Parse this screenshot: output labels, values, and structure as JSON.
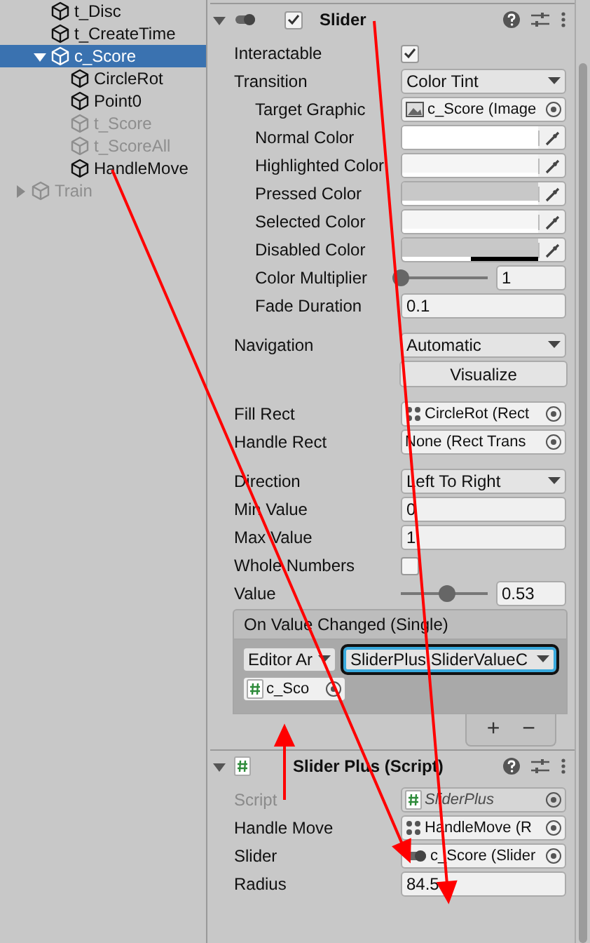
{
  "hierarchy": {
    "items": [
      {
        "label": "t_Disc",
        "selected": false,
        "disabled": false
      },
      {
        "label": "t_CreateTime",
        "selected": false,
        "disabled": false
      },
      {
        "label": "c_Score",
        "selected": true,
        "disabled": false,
        "expanded": true,
        "children": [
          {
            "label": "CircleRot",
            "selected": false,
            "disabled": false
          },
          {
            "label": "Point0",
            "selected": false,
            "disabled": false
          },
          {
            "label": "t_Score",
            "selected": false,
            "disabled": true
          },
          {
            "label": "t_ScoreAll",
            "selected": false,
            "disabled": true
          },
          {
            "label": "HandleMove",
            "selected": false,
            "disabled": false
          }
        ]
      }
    ],
    "root_items": [
      {
        "label": "Train",
        "selected": false,
        "disabled": true,
        "expanded": false
      }
    ]
  },
  "inspector": {
    "components": [
      {
        "title": "Slider",
        "kind": "slider",
        "expanded": true,
        "enabled": true,
        "groups": [
          [
            {
              "kind": "checkbox",
              "label": "Interactable",
              "checked": true
            },
            {
              "kind": "dropdown",
              "label": "Transition",
              "value": "Color Tint",
              "children": [
                {
                  "kind": "object",
                  "label": "Target Graphic",
                  "ref": {
                    "kind": "image",
                    "value": "c_Score (Image"
                  },
                  "disabled": false
                },
                {
                  "kind": "color",
                  "label": "Normal Color",
                  "color": "#ffffff",
                  "level": 1
                },
                {
                  "kind": "color",
                  "label": "Highlighted Color",
                  "color": "#f5f5f5",
                  "level": 1
                },
                {
                  "kind": "color",
                  "label": "Pressed Color",
                  "color": "#c8c8c8",
                  "level": 1
                },
                {
                  "kind": "color",
                  "label": "Selected Color",
                  "color": "#f5f5f5",
                  "level": 1
                },
                {
                  "kind": "color",
                  "label": "Disabled Color",
                  "color": "#c8c8c8",
                  "level": 0.5
                },
                {
                  "kind": "slider",
                  "label": "Color Multiplier",
                  "level": 0,
                  "value": "1"
                },
                {
                  "kind": "number",
                  "label": "Fade Duration",
                  "value": "0.1"
                }
              ]
            }
          ],
          [
            {
              "kind": "dropdown",
              "label": "Navigation",
              "value": "Automatic"
            },
            {
              "kind": "button",
              "value": "Visualize"
            }
          ],
          [
            {
              "kind": "object",
              "label": "Fill Rect",
              "ref": {
                "kind": "rect",
                "value": "CircleRot (Rect"
              },
              "disabled": false
            },
            {
              "kind": "object",
              "label": "Handle Rect",
              "ref": {
                "kind": "none",
                "value": "None (Rect Trans"
              },
              "disabled": false
            }
          ],
          [
            {
              "kind": "dropdown",
              "label": "Direction",
              "value": "Left To Right"
            },
            {
              "kind": "number",
              "label": "Min Value",
              "value": "0"
            },
            {
              "kind": "number",
              "label": "Max Value",
              "value": "1"
            },
            {
              "kind": "checkbox",
              "label": "Whole Numbers",
              "checked": false
            },
            {
              "kind": "slider",
              "label": "Value",
              "level": 0.53,
              "value": "0.53"
            }
          ]
        ],
        "event": {
          "title": "On Value Changed (Single)",
          "entries": [
            {
              "runtime": "Editor Ar",
              "function": "SliderPlus.SliderValueC",
              "function_selected": true,
              "object": "c_Sco"
            }
          ],
          "add": "+",
          "remove": "−"
        }
      },
      {
        "title": "Slider Plus (Script)",
        "kind": "script",
        "expanded": true,
        "groups": [
          [
            {
              "kind": "object",
              "label": "Script",
              "ref": {
                "kind": "script",
                "value": "SliderPlus"
              },
              "disabled": true
            },
            {
              "kind": "object",
              "label": "Handle Move",
              "ref": {
                "kind": "rect",
                "value": "HandleMove (R"
              },
              "disabled": false
            },
            {
              "kind": "object",
              "label": "Slider",
              "ref": {
                "kind": "slider",
                "value": "c_Score (Slider"
              },
              "disabled": false
            },
            {
              "kind": "number",
              "label": "Radius",
              "value": "84.5"
            }
          ]
        ]
      }
    ]
  }
}
